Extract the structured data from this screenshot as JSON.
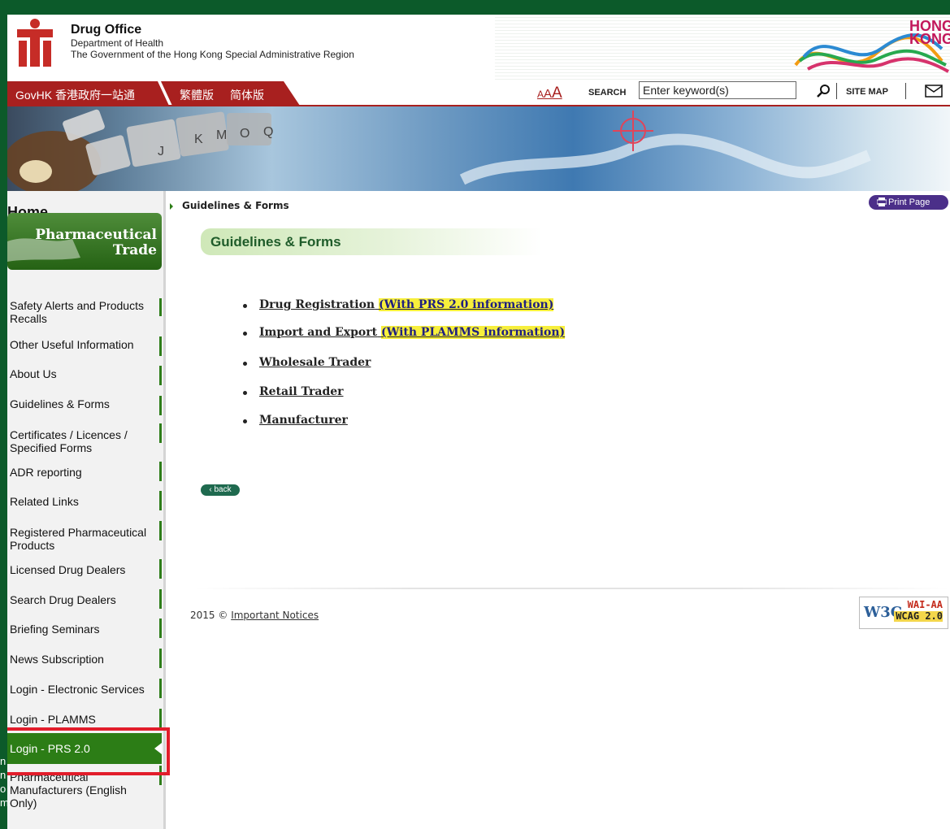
{
  "colors": {
    "brand_green": "#0c5a2a",
    "nav_red": "#a8201f",
    "sidebar_active": "#2c7d16",
    "highlight_box": "#e21d2b",
    "link_highlight": "#f7ef3c",
    "print_button": "#4b2f89"
  },
  "header": {
    "title": "Drug Office",
    "department": "Department of Health",
    "government": "The Government of the Hong Kong Special Administrative Region",
    "hk_brand": [
      "HONG",
      "KONG"
    ]
  },
  "nav": {
    "govhk": "GovHK 香港政府一站通",
    "lang_traditional": "繁體版",
    "lang_simplified": "简体版",
    "font_sizes": [
      "A",
      "A",
      "A"
    ],
    "search_label": "SEARCH",
    "search_placeholder": "Enter keyword(s)",
    "sitemap": "SITE MAP",
    "icons": [
      "search-icon",
      "mail-icon"
    ]
  },
  "banner": {
    "keys": [
      "J",
      "K",
      "M",
      "O",
      "Q"
    ]
  },
  "sidebar": {
    "home": "Home",
    "section_title_1": "Pharmaceutical",
    "section_title_2": "Trade",
    "items": [
      {
        "label": "Safety Alerts and Products Recalls",
        "active": false
      },
      {
        "label": "Other Useful Information",
        "active": false
      },
      {
        "label": "About Us",
        "active": false
      },
      {
        "label": "Guidelines & Forms",
        "active": false
      },
      {
        "label": "Certificates / Licences / Specified Forms",
        "active": false
      },
      {
        "label": "ADR reporting",
        "active": false
      },
      {
        "label": "Related Links",
        "active": false
      },
      {
        "label": "Registered Pharmaceutical Products",
        "active": false
      },
      {
        "label": "Licensed Drug Dealers",
        "active": false
      },
      {
        "label": "Search Drug Dealers",
        "active": false
      },
      {
        "label": "Briefing Seminars",
        "active": false
      },
      {
        "label": "News Subscription",
        "active": false
      },
      {
        "label": "Login - Electronic Services",
        "active": false
      },
      {
        "label": "Login - PLAMMS",
        "active": false
      },
      {
        "label": "Login - PRS 2.0",
        "active": true
      },
      {
        "label": "Pharmaceutical Manufacturers (English Only)",
        "active": false
      }
    ]
  },
  "breadcrumb": "Guidelines & Forms",
  "print_label": "Print Page",
  "page_title": "Guidelines & Forms",
  "links": [
    {
      "label": "Drug Registration",
      "highlight": "(With PRS 2.0 information)"
    },
    {
      "label": "Import and Export",
      "highlight": "(With PLAMMS information)"
    },
    {
      "label": "Wholesale Trader",
      "highlight": ""
    },
    {
      "label": "Retail Trader",
      "highlight": ""
    },
    {
      "label": "Manufacturer",
      "highlight": ""
    }
  ],
  "back_label": "back",
  "footer": {
    "year": "2015 ©",
    "notices": "Important Notices"
  },
  "badge": {
    "w3c": "W3C",
    "wai": "WAI-AA",
    "wcag": "WCAG 2.0"
  },
  "edge_text": [
    "n",
    "n",
    "o",
    "m"
  ]
}
